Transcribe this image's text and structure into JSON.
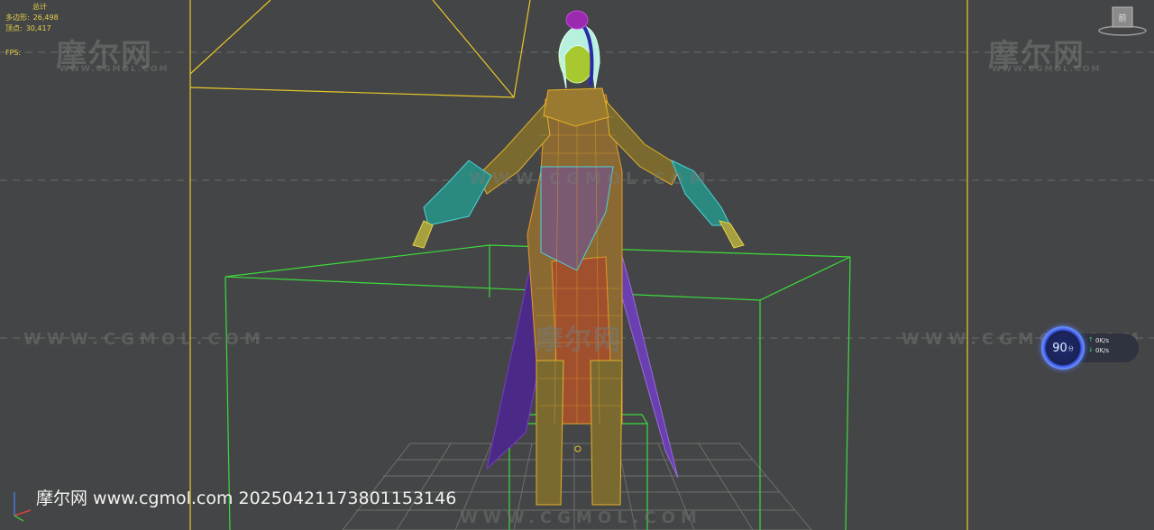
{
  "viewport": {
    "stats": {
      "title": "总计",
      "polygons_label": "多边形:",
      "polygons_value": "26,498",
      "vertices_label": "顶点:",
      "vertices_value": "30,417",
      "fps_label": "FPS:"
    },
    "watermark": {
      "brand": "摩尔网",
      "domain_small": "WWW.CGMOL.COM",
      "domain_line": "WWW.CGMOL.COM"
    },
    "caption": "摩尔网 www.cgmol.com 20250421173801153146",
    "perf_widget": {
      "score": "90",
      "score_unit": "分",
      "upload": "0K/s",
      "download": "0K/s"
    },
    "viewcube_label": "前",
    "icons": {
      "viewcube": "viewcube-icon",
      "axis": "axis-tripod-icon",
      "upload": "arrow-up-icon",
      "download": "arrow-down-icon"
    },
    "colors": {
      "background": "#444546",
      "selection_yellow": "#e8c82a",
      "bbox_green": "#3cdc3c",
      "wire_orange": "#e39a2a",
      "wire_cyan": "#4fd2d8",
      "wire_purple": "#7a3cc8",
      "accent_blue": "#3d5df0"
    }
  }
}
